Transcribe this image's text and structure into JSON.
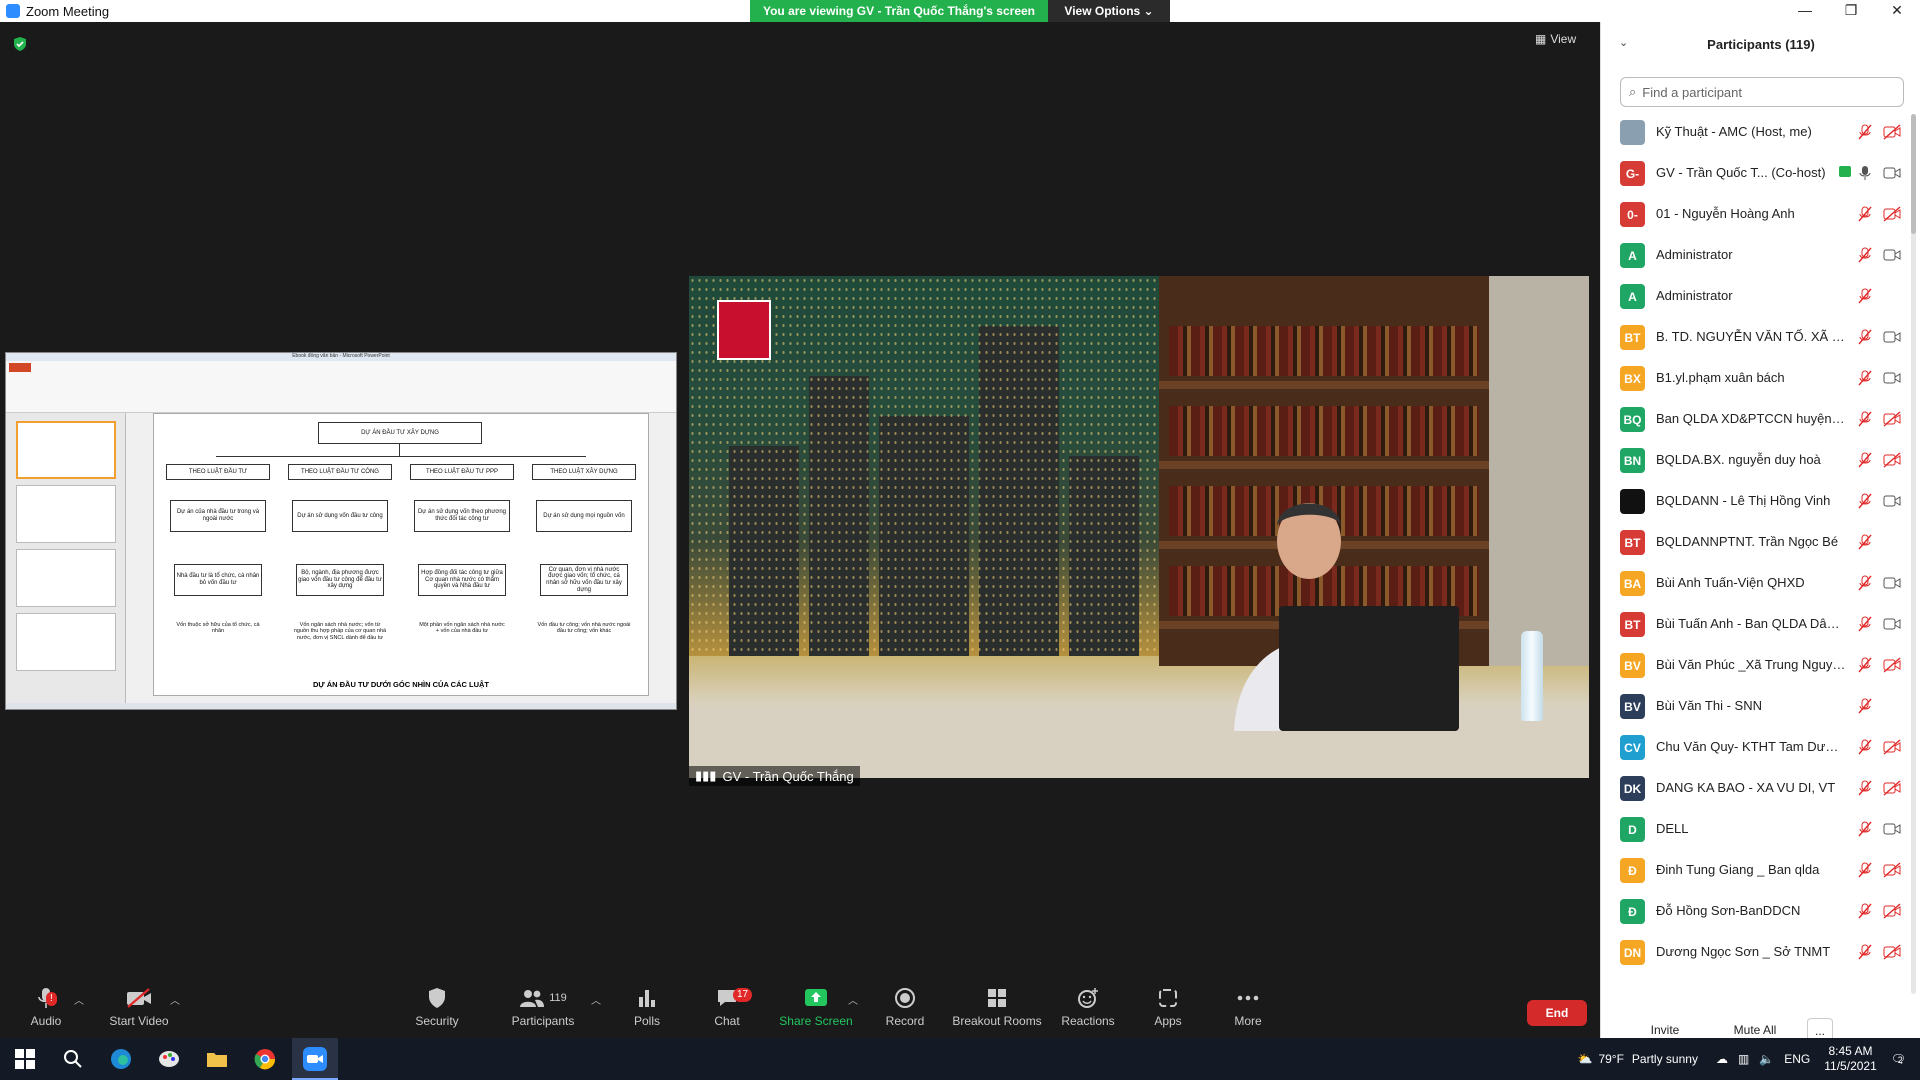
{
  "window": {
    "title": "Zoom Meeting"
  },
  "banner": {
    "viewing_text": "You are viewing GV - Trần Quốc Thắng's screen",
    "view_options": "View Options"
  },
  "stage": {
    "view_label": "View"
  },
  "shared_screen": {
    "ppt_title": "Ebook đồng văn bản - Microsoft PowerPoint",
    "slide": {
      "top_box": "DỰ ÁN ĐẦU TƯ XÂY DỰNG",
      "law_boxes": [
        "THEO LUẬT ĐẦU TƯ",
        "THEO LUẬT ĐẦU TƯ CÔNG",
        "THEO LUẬT ĐẦU TƯ PPP",
        "THEO LUẬT XÂY DỰNG"
      ],
      "project_boxes": [
        "Dự án của nhà đầu tư trong và ngoài nước",
        "Dự án sử dụng vốn đầu tư công",
        "Dự án sử dụng vốn theo phương thức đối tác công tư",
        "Dự án sử dụng mọi nguồn vốn"
      ],
      "who_boxes": [
        "Nhà đầu tư là tổ chức, cá nhân bỏ vốn đầu tư",
        "Bộ, ngành, địa phương được giao vốn đầu tư công để đầu tư xây dựng",
        "Hợp đồng đối tác công tư giữa Cơ quan nhà nước có thẩm quyền và Nhà đầu tư",
        "Cơ quan, đơn vị nhà nước được giao vốn; tổ chức, cá nhân sở hữu vốn đầu tư xây dựng"
      ],
      "fund_notes": [
        "Vốn thuộc sở hữu của tổ chức, cá nhân",
        "Vốn ngân sách nhà nước; vốn từ nguồn thu hợp pháp của cơ quan nhà nước, đơn vị SNCL dành để đầu tư",
        "Một phần vốn ngân sách nhà nước + vốn của nhà đầu tư",
        "Vốn đầu tư công; vốn nhà nước ngoài đầu tư công; vốn khác"
      ],
      "footer": "DỰ ÁN ĐẦU TƯ DƯỚI GÓC NHÌN CỦA CÁC LUẬT"
    }
  },
  "video": {
    "name": "GV - Trần Quốc Thắng"
  },
  "toolbar": {
    "audio": "Audio",
    "audio_badge": "!",
    "start_video": "Start Video",
    "security": "Security",
    "participants": "Participants",
    "participants_count": "119",
    "polls": "Polls",
    "chat": "Chat",
    "chat_badge": "17",
    "share_screen": "Share Screen",
    "record": "Record",
    "breakout_rooms": "Breakout Rooms",
    "reactions": "Reactions",
    "apps": "Apps",
    "more": "More",
    "end": "End",
    "share_color": "#22c55e"
  },
  "panel": {
    "title": "Participants (119)",
    "search_placeholder": "Find a participant",
    "invite": "Invite",
    "mute_all": "Mute All",
    "more": "...",
    "participants": [
      {
        "initials": "",
        "name": "Kỹ Thuật - AMC (Host, me)",
        "color": "#8aa0b0",
        "mic": "muted",
        "cam": "off"
      },
      {
        "initials": "G-",
        "name": "GV - Trần Quốc T... (Co-host)",
        "color": "#d63b35",
        "mic": "on",
        "cam": "on",
        "sharing": true
      },
      {
        "initials": "0-",
        "name": "01 - Nguyễn Hoàng Anh",
        "color": "#d63b35",
        "mic": "muted",
        "cam": "off"
      },
      {
        "initials": "A",
        "name": "Administrator",
        "color": "#1fa564",
        "mic": "muted",
        "cam": "on"
      },
      {
        "initials": "A",
        "name": "Administrator",
        "color": "#1fa564",
        "mic": "muted",
        "cam": "none"
      },
      {
        "initials": "BT",
        "name": "B. TD. NGUYỄN VĂN TỐ. XÃ VÂ...",
        "color": "#f5a623",
        "mic": "muted",
        "cam": "on"
      },
      {
        "initials": "BX",
        "name": "B1.yl.phạm xuân bách",
        "color": "#f5a623",
        "mic": "muted",
        "cam": "on"
      },
      {
        "initials": "BQ",
        "name": "Ban QLDA XD&PTCCN huyện Yê...",
        "color": "#1fa564",
        "mic": "muted",
        "cam": "off"
      },
      {
        "initials": "BN",
        "name": "BQLDA.BX. nguyễn duy hoà",
        "color": "#1fa564",
        "mic": "muted",
        "cam": "off"
      },
      {
        "initials": "",
        "name": "BQLDANN - Lê Thị Hồng Vinh",
        "color": "#111111",
        "mic": "muted",
        "cam": "on"
      },
      {
        "initials": "BT",
        "name": "BQLDANNPTNT. Trần Ngọc Bé",
        "color": "#d63b35",
        "mic": "muted",
        "cam": "none"
      },
      {
        "initials": "BA",
        "name": "Bùi Anh Tuấn-Viện QHXD",
        "color": "#f5a623",
        "mic": "muted",
        "cam": "on"
      },
      {
        "initials": "BT",
        "name": "Bùi Tuấn Anh - Ban QLDA Dân d...",
        "color": "#d63b35",
        "mic": "muted",
        "cam": "on"
      },
      {
        "initials": "BV",
        "name": "Bùi Văn Phúc _Xã Trung Nguyên",
        "color": "#f5a623",
        "mic": "muted",
        "cam": "off"
      },
      {
        "initials": "BV",
        "name": "Bùi Văn Thi - SNN",
        "color": "#2c3e5a",
        "mic": "muted",
        "cam": "none"
      },
      {
        "initials": "CV",
        "name": "Chu Văn Quy- KTHT Tam Dương",
        "color": "#1e9fd0",
        "mic": "muted",
        "cam": "off"
      },
      {
        "initials": "DK",
        "name": "DANG KA BAO - XA VU DI, VT",
        "color": "#2c3e5a",
        "mic": "muted",
        "cam": "off"
      },
      {
        "initials": "D",
        "name": "DELL",
        "color": "#1fa564",
        "mic": "muted",
        "cam": "on"
      },
      {
        "initials": "Đ",
        "name": "Đinh Tung Giang _ Ban qlda",
        "color": "#f5a623",
        "mic": "muted",
        "cam": "off"
      },
      {
        "initials": "Đ",
        "name": "Đỗ Hồng Sơn-BanDDCN",
        "color": "#1fa564",
        "mic": "muted",
        "cam": "off"
      },
      {
        "initials": "DN",
        "name": "Dương Ngọc Sơn _ Sở TNMT",
        "color": "#f5a623",
        "mic": "muted",
        "cam": "off"
      }
    ]
  },
  "taskbar": {
    "weather_temp": "79°F",
    "weather_text": "Partly sunny",
    "language": "ENG",
    "time": "8:45 AM",
    "date": "11/5/2021",
    "notifications": "2"
  }
}
